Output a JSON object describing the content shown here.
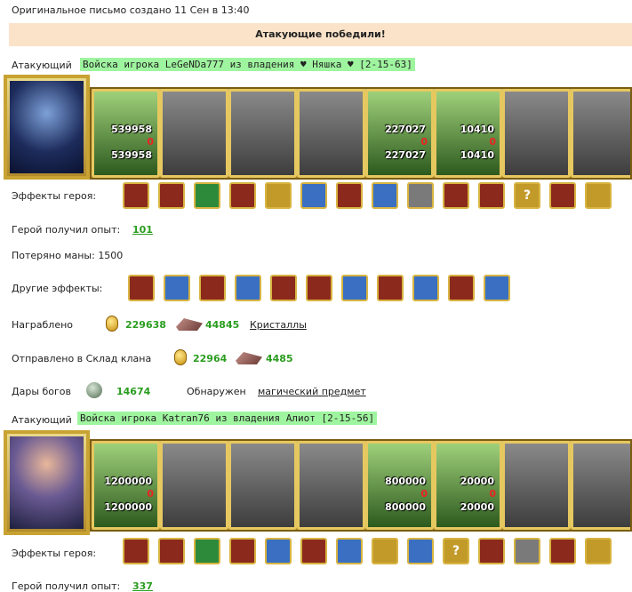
{
  "header": {
    "date": "Оригинальное письмо создано 11 Сен в 13:40",
    "banner": "Атакующие победили!"
  },
  "attacker1": {
    "role": "Атакующий",
    "army_title": "Войска игрока LeGeNDa777 из владения ♥ Няшка ♥ [2-15-63]",
    "units": [
      {
        "color": true,
        "top": "539958",
        "bottom": "539958"
      },
      {
        "color": false
      },
      {
        "color": false
      },
      {
        "color": false
      },
      {
        "color": true,
        "top": "227027",
        "bottom": "227027"
      },
      {
        "color": true,
        "top": "10410",
        "bottom": "10410"
      },
      {
        "color": false
      },
      {
        "color": false
      }
    ],
    "effects_label": "Эффекты героя:",
    "exp_label": "Герой получил опыт:",
    "exp": "101",
    "mana_text": "Потеряно маны: 1500",
    "other_effects_label": "Другие эффекты:",
    "loot_label": "Награблено",
    "loot_gold": "229638",
    "loot_crystals": "44845",
    "crystals_link": "Кристаллы",
    "clan_label": "Отправлено в Склад клана",
    "clan_gold": "22964",
    "clan_crystals": "4485",
    "gifts_label": "Дары богов",
    "gifts_value": "14674",
    "found_label": "Обнаружен",
    "found_link": "магический предмет"
  },
  "attacker2": {
    "role": "Атакующий",
    "army_title": "Войска игрока Katran76 из владения Алиот [2-15-56]",
    "units": [
      {
        "color": true,
        "top": "1200000",
        "bottom": "1200000"
      },
      {
        "color": false
      },
      {
        "color": false
      },
      {
        "color": false
      },
      {
        "color": true,
        "top": "800000",
        "bottom": "800000"
      },
      {
        "color": true,
        "top": "20000",
        "bottom": "20000"
      },
      {
        "color": false
      },
      {
        "color": false
      }
    ],
    "effects_label": "Эффекты героя:",
    "exp_label": "Герой получил опыт:",
    "exp": "337"
  },
  "zero_mark": "0",
  "help_glyph": "?",
  "icons1": [
    "helmet-icon",
    "dice-icon",
    "shield-icon",
    "handshake-icon",
    "scroll-icon",
    "sword-icon",
    "handshake-icon",
    "hand-icon",
    "barrel-icon",
    "fist-icon",
    "compass-icon",
    "help-icon",
    "rune-icon",
    "harp-icon"
  ],
  "icons_other": [
    "fist-sword-icon",
    "sword-icon",
    "fist-sword-icon",
    "sword-icon",
    "fist-sword-icon",
    "hearts-icon",
    "sword-icon",
    "fist-sword-icon",
    "sword-icon",
    "fist-sword-icon",
    "sword-icon"
  ],
  "icons2": [
    "helmet-icon",
    "dice-icon",
    "shield-icon",
    "handshake-icon",
    "sword-icon",
    "handshake-icon",
    "hand-icon",
    "scroll-icon",
    "claw-icon",
    "help-icon",
    "rune-icon",
    "ring-icon",
    "fist-icon",
    "bow-icon"
  ]
}
